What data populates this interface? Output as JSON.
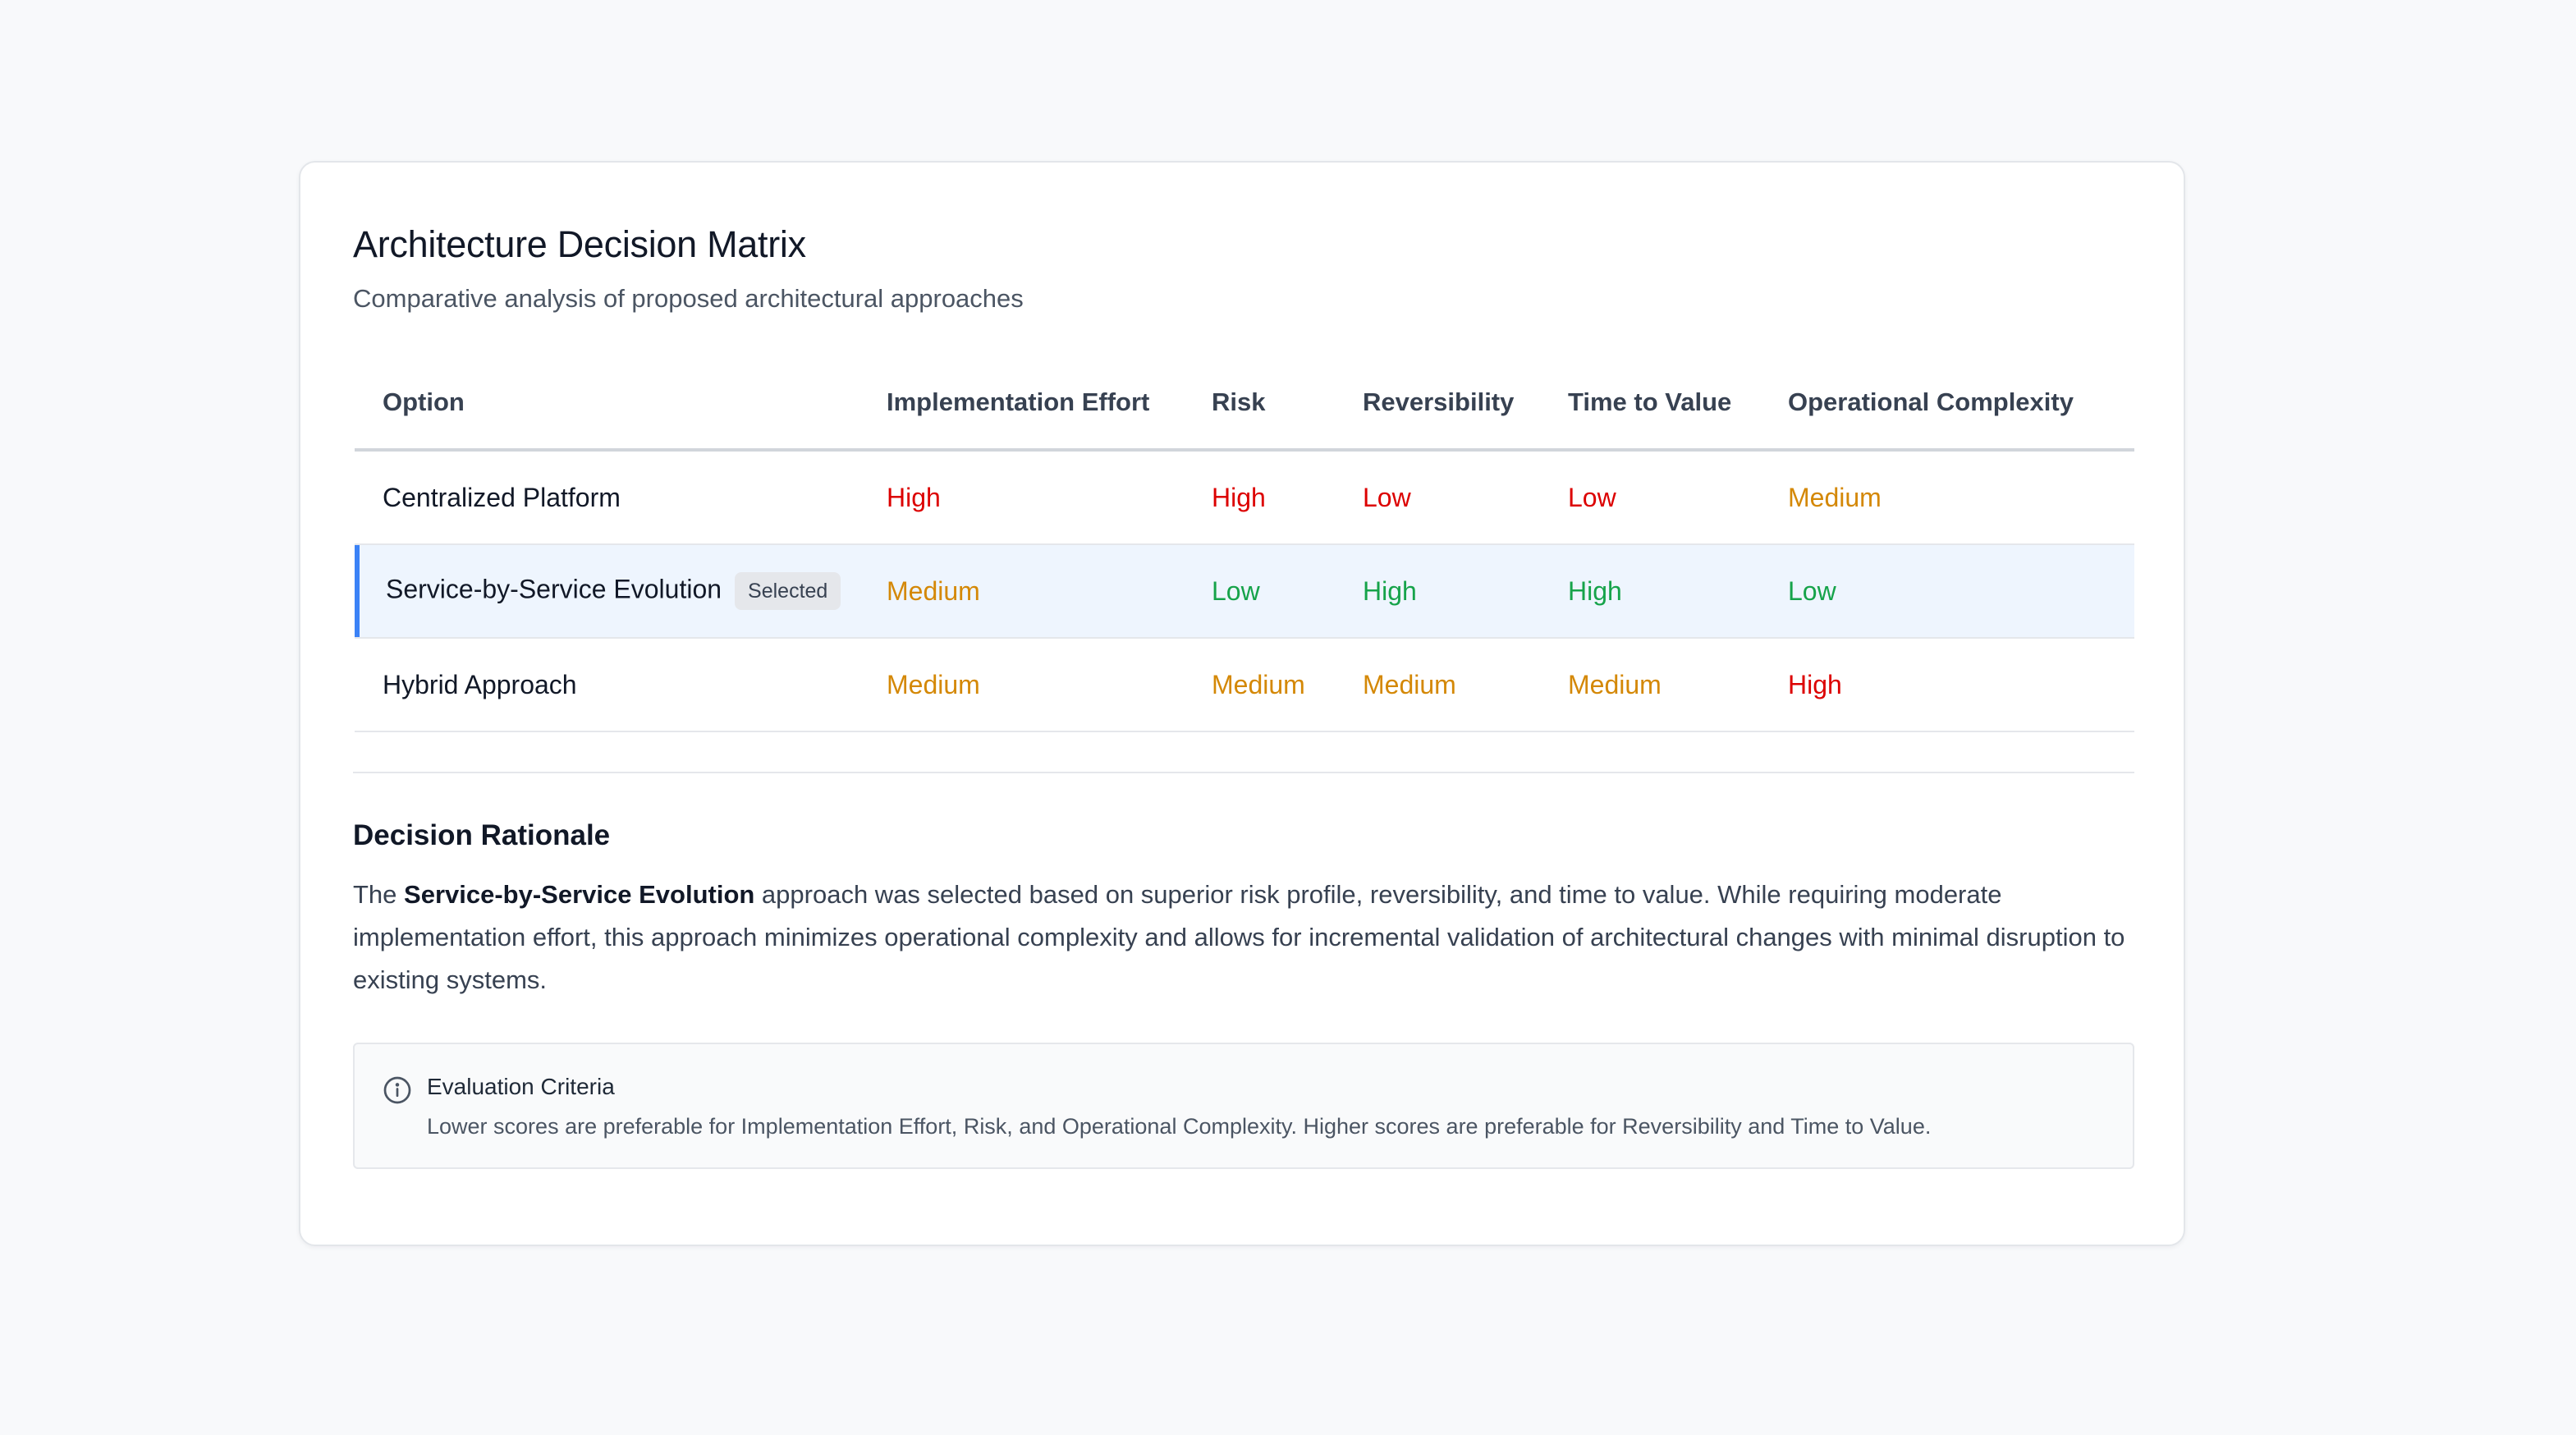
{
  "card": {
    "title": "Architecture Decision Matrix",
    "subtitle": "Comparative analysis of proposed architectural approaches"
  },
  "matrix": {
    "headers": [
      "Option",
      "Implementation Effort",
      "Risk",
      "Reversibility",
      "Time to Value",
      "Operational Complexity"
    ],
    "rows": [
      {
        "option": "Centralized Platform",
        "selected": false,
        "values": [
          "High",
          "High",
          "Low",
          "Low",
          "Medium"
        ],
        "tones": [
          "bad",
          "bad",
          "bad",
          "bad",
          "mid"
        ]
      },
      {
        "option": "Service-by-Service Evolution",
        "selected": true,
        "badge": "Selected",
        "values": [
          "Medium",
          "Low",
          "High",
          "High",
          "Low"
        ],
        "tones": [
          "mid",
          "good",
          "good",
          "good",
          "good"
        ]
      },
      {
        "option": "Hybrid Approach",
        "selected": false,
        "values": [
          "Medium",
          "Medium",
          "Medium",
          "Medium",
          "High"
        ],
        "tones": [
          "mid",
          "mid",
          "mid",
          "mid",
          "bad"
        ]
      }
    ]
  },
  "colors": {
    "bad": "#dc0000",
    "mid": "#d48806",
    "good": "#16a34a",
    "selected_accent": "#3b82f6",
    "selected_row_bg": "#eef5fe"
  },
  "rationale": {
    "title": "Decision Rationale",
    "prefix": "The ",
    "highlight": "Service-by-Service Evolution",
    "suffix": " approach was selected based on superior risk profile, reversibility, and time to value. While requiring moderate implementation effort, this approach minimizes operational complexity and allows for incremental validation of architectural changes with minimal disruption to existing systems."
  },
  "criteria": {
    "icon": "info-icon",
    "title": "Evaluation Criteria",
    "text": "Lower scores are preferable for Implementation Effort, Risk, and Operational Complexity. Higher scores are preferable for Reversibility and Time to Value."
  }
}
